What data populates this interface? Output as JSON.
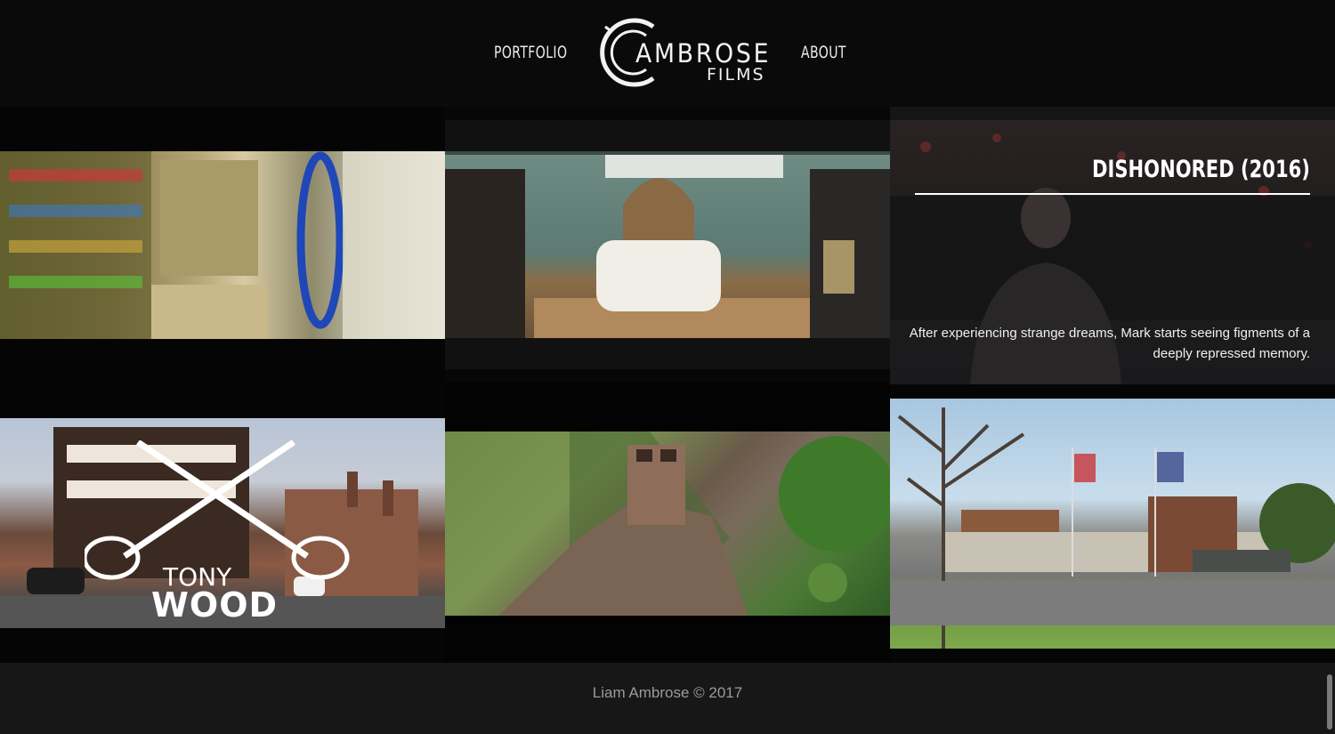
{
  "nav": {
    "portfolio": "PORTFOLIO",
    "about": "ABOUT"
  },
  "logo": {
    "line1": "AMBROSE",
    "line2": "FILMS"
  },
  "portfolio": {
    "featured": {
      "title": "DISHONORED (2016)",
      "description": "After experiencing strange dreams, Mark starts seeing figments of a deeply repressed memory."
    },
    "tony_wood": {
      "line1": "TONY",
      "line2": "WOOD"
    }
  },
  "footer": {
    "copyright": "Liam Ambrose © 2017"
  },
  "colors": {
    "background": "#070707",
    "header": "#0a0a0a",
    "footer": "#171717",
    "text": "#ffffff"
  }
}
